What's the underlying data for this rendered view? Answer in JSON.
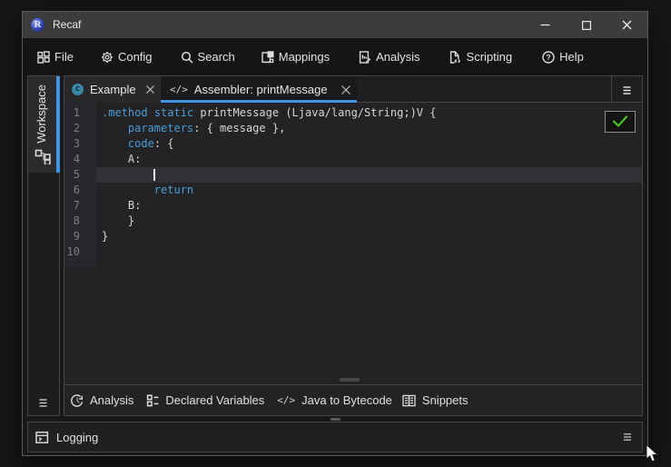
{
  "colors": {
    "accent_blue": "#3f94e4",
    "keyword_blue": "#4a9cd6",
    "check_green": "#4fce27",
    "class_icon_teal": "#3a87a8"
  },
  "title_bar": {
    "app_title": "Recaf",
    "controls": [
      {
        "name": "minimize"
      },
      {
        "name": "maximize"
      },
      {
        "name": "close"
      }
    ]
  },
  "menu": {
    "items": [
      {
        "label": "File",
        "icon": "workspace-squares-icon"
      },
      {
        "label": "Config",
        "icon": "gear-icon"
      },
      {
        "label": "Search",
        "icon": "magnifier-icon"
      },
      {
        "label": "Mappings",
        "icon": "mapping-icon"
      },
      {
        "label": "Analysis",
        "icon": "document-chart-pen-icon"
      },
      {
        "label": "Scripting",
        "icon": "script-file-icon"
      },
      {
        "label": "Help",
        "icon": "question-circle-icon"
      }
    ]
  },
  "sidebar": {
    "workspace_tab_label": "Workspace"
  },
  "tabs": [
    {
      "label": "Example",
      "icon": "class-icon",
      "icon_letter": "c",
      "selected": false
    },
    {
      "label": "Assembler: printMessage",
      "icon": "code-icon",
      "icon_text": "</>",
      "selected": true
    }
  ],
  "editor": {
    "gutter_numbers": [
      "1",
      "2",
      "3",
      "4",
      "5",
      "6",
      "7",
      "8",
      "9",
      "10"
    ],
    "current_line": 5,
    "caret": {
      "line": 5,
      "column": 8
    },
    "lines": [
      {
        "tokens": [
          {
            "text": ".method",
            "type": "kw"
          },
          {
            "text": " ",
            "type": "pl"
          },
          {
            "text": "static",
            "type": "kw"
          },
          {
            "text": " printMessage (Ljava/lang/String;)V {",
            "type": "pl"
          }
        ]
      },
      {
        "tokens": [
          {
            "text": "    ",
            "type": "pl"
          },
          {
            "text": "parameters",
            "type": "kw"
          },
          {
            "text": ": { message },",
            "type": "pl"
          }
        ]
      },
      {
        "tokens": [
          {
            "text": "    ",
            "type": "pl"
          },
          {
            "text": "code",
            "type": "kw"
          },
          {
            "text": ": {",
            "type": "pl"
          }
        ]
      },
      {
        "tokens": [
          {
            "text": "    A:",
            "type": "pl"
          }
        ]
      },
      {
        "tokens": []
      },
      {
        "tokens": [
          {
            "text": "        ",
            "type": "pl"
          },
          {
            "text": "return",
            "type": "kw"
          }
        ]
      },
      {
        "tokens": [
          {
            "text": "    B:",
            "type": "pl"
          }
        ]
      },
      {
        "tokens": [
          {
            "text": "    }",
            "type": "pl"
          }
        ]
      },
      {
        "tokens": [
          {
            "text": "}",
            "type": "pl"
          }
        ]
      },
      {
        "tokens": []
      }
    ],
    "validation_button": {
      "state": "ok",
      "icon": "check-icon"
    }
  },
  "editor_toolbar": {
    "items": [
      {
        "label": "Analysis",
        "icon": "history-clock-icon"
      },
      {
        "label": "Declared Variables",
        "icon": "list-boxes-icon"
      },
      {
        "label": "Java to Bytecode",
        "icon": "code-icon",
        "icon_text": "</>"
      },
      {
        "label": "Snippets",
        "icon": "catalog-book-icon"
      }
    ]
  },
  "logging": {
    "label": "Logging",
    "icon": "terminal-window-icon"
  }
}
